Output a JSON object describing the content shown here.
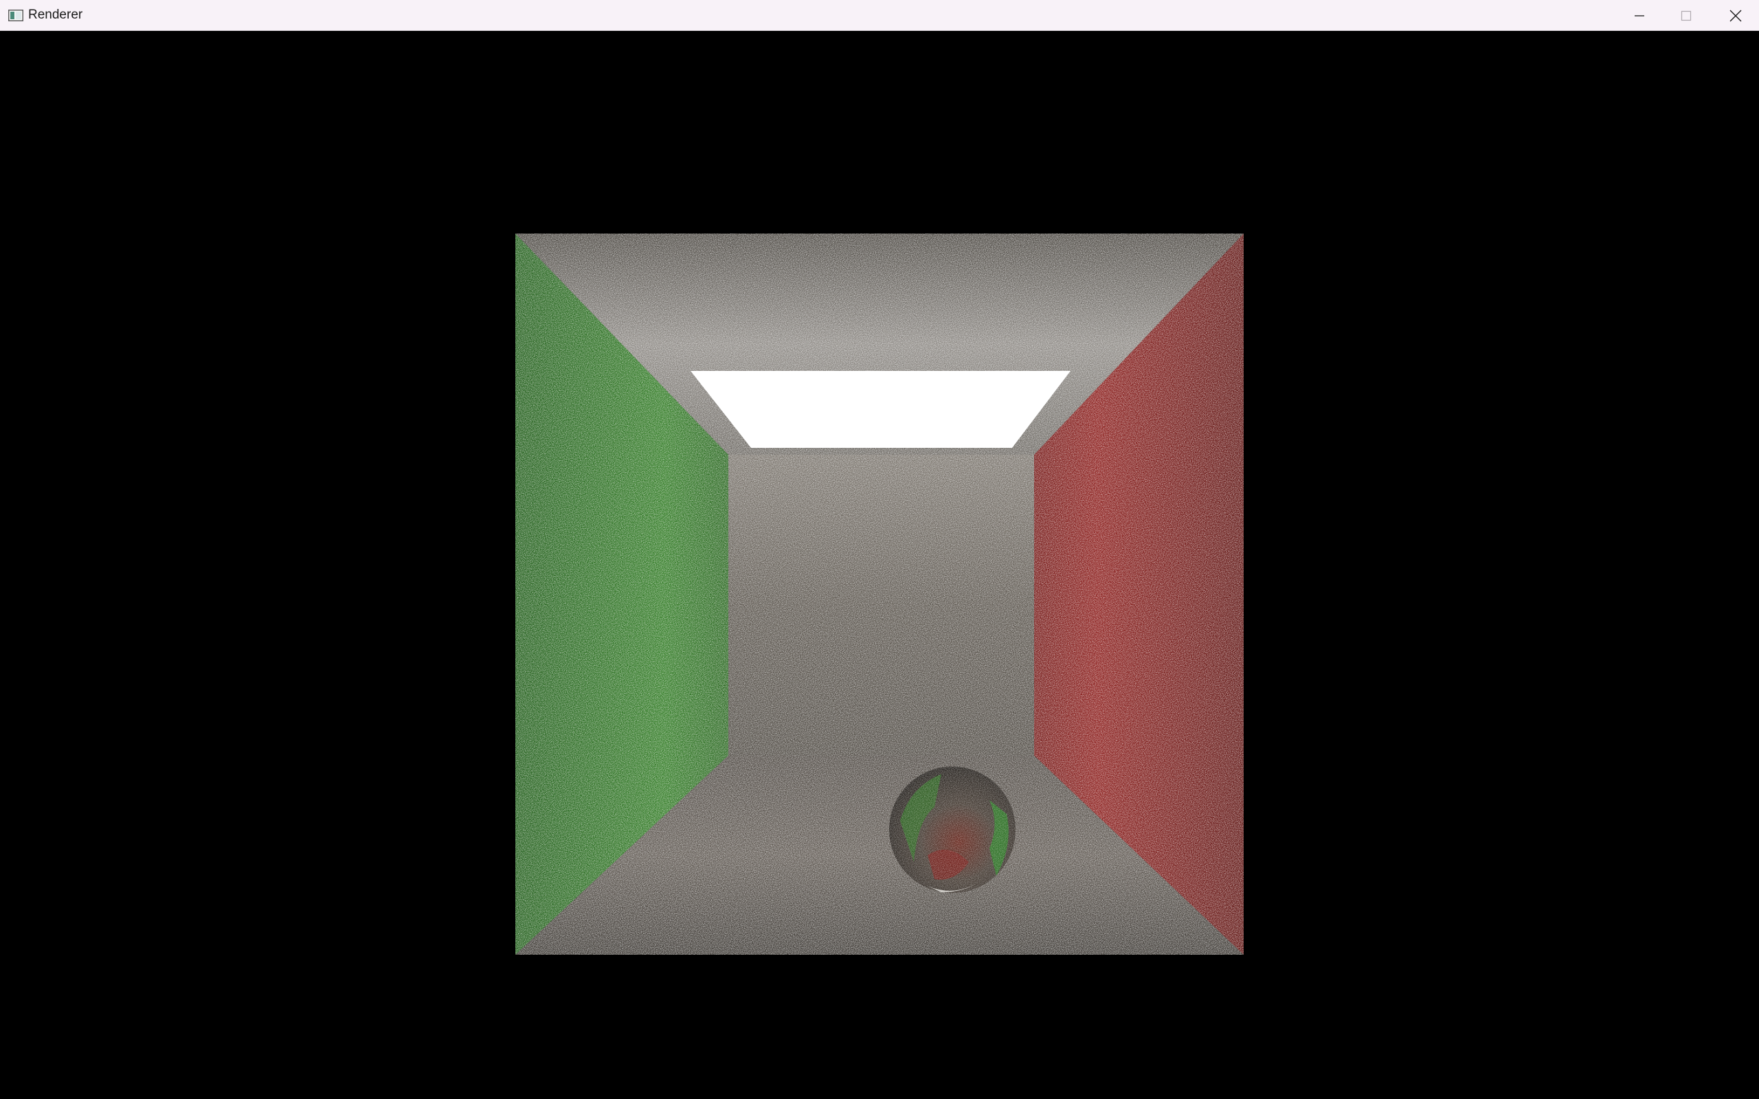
{
  "window": {
    "title": "Renderer",
    "icon": "app-window-icon"
  },
  "controls": {
    "minimize_icon": "minimize-icon",
    "maximize_icon": "maximize-icon",
    "close_icon": "close-icon"
  },
  "scene": {
    "left_wall_color": "#2f7a22",
    "right_wall_color": "#8a1a18",
    "back_wall_color": "#5a5448",
    "floor_color": "#5a5248",
    "ceiling_color": "#8a8680",
    "light_color": "#ffffff"
  }
}
